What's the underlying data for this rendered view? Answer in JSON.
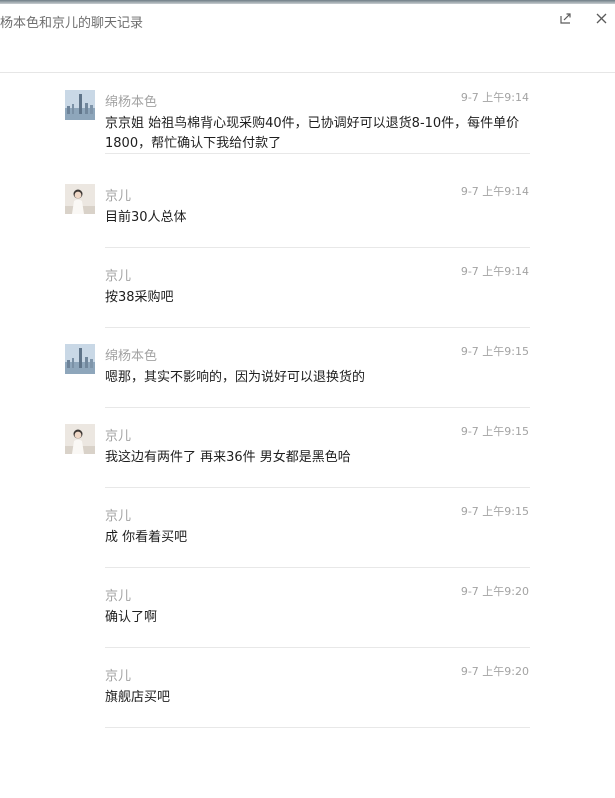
{
  "window": {
    "title": "杨本色和京儿的聊天记录"
  },
  "icons": {
    "share": "share-icon",
    "close": "close-icon"
  },
  "messages": [
    {
      "sender": "绵杨本色",
      "time": "9-7 上午9:14",
      "text": "京京姐 始祖鸟棉背心现采购40件，已协调好可以退货8-10件，每件单价1800，帮忙确认下我给付款了",
      "avatar": "city-avatar"
    },
    {
      "sender": "京儿",
      "time": "9-7 上午9:14",
      "text": "目前30人总体",
      "avatar": "person-avatar"
    },
    {
      "sender": "京儿",
      "time": "9-7 上午9:14",
      "text": "按38采购吧",
      "avatar": ""
    },
    {
      "sender": "绵杨本色",
      "time": "9-7 上午9:15",
      "text": "嗯那，其实不影响的，因为说好可以退换货的",
      "avatar": "city-avatar"
    },
    {
      "sender": "京儿",
      "time": "9-7 上午9:15",
      "text": "我这边有两件了 再来36件 男女都是黑色哈",
      "avatar": "person-avatar"
    },
    {
      "sender": "京儿",
      "time": "9-7 上午9:15",
      "text": "成 你看着买吧",
      "avatar": ""
    },
    {
      "sender": "京儿",
      "time": "9-7 上午9:20",
      "text": "确认了啊",
      "avatar": ""
    },
    {
      "sender": "京儿",
      "time": "9-7 上午9:20",
      "text": "旗舰店买吧",
      "avatar": ""
    }
  ]
}
